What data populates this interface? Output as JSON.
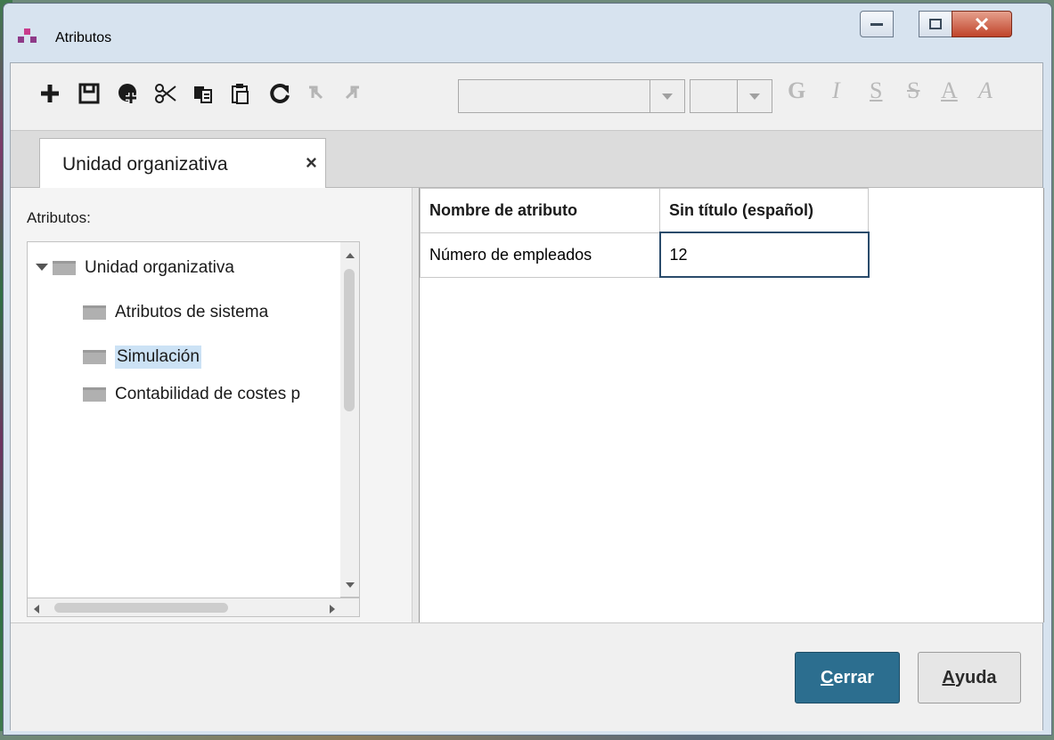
{
  "window": {
    "title": "Atributos",
    "controls": [
      "minimize",
      "maximize",
      "close"
    ]
  },
  "toolbar": {
    "icons": [
      "add-icon",
      "save-icon",
      "add-circle-icon",
      "cut-icon",
      "copy-icon",
      "paste-icon",
      "refresh-icon",
      "undo-icon",
      "redo-icon"
    ],
    "font_combo_value": "",
    "size_combo_value": "",
    "format": {
      "bold": "G",
      "italic": "I",
      "underline": "S",
      "strikethrough": "S",
      "font_color": "A",
      "highlight": "A"
    }
  },
  "tab": {
    "label": "Unidad organizativa",
    "close": "×"
  },
  "left_pane": {
    "label": "Atributos:",
    "tree": [
      {
        "label": "Unidad organizativa",
        "expanded": true,
        "level": 0
      },
      {
        "label": "Atributos de sistema",
        "level": 1
      },
      {
        "label": "Simulación",
        "level": 1,
        "selected": true
      },
      {
        "label": "Contabilidad de costes p",
        "level": 1
      }
    ]
  },
  "table": {
    "headers": [
      "Nombre de atributo",
      "Sin título (español)"
    ],
    "rows": [
      [
        "Número de empleados",
        "12"
      ]
    ]
  },
  "buttons": {
    "close": {
      "mnemonic": "C",
      "rest": "errar"
    },
    "help": {
      "mnemonic": "A",
      "rest": "yuda"
    }
  },
  "colors": {
    "primary_button": "#2c6e8f",
    "selection": "#cce2f5",
    "close_button": "#c0442a"
  }
}
